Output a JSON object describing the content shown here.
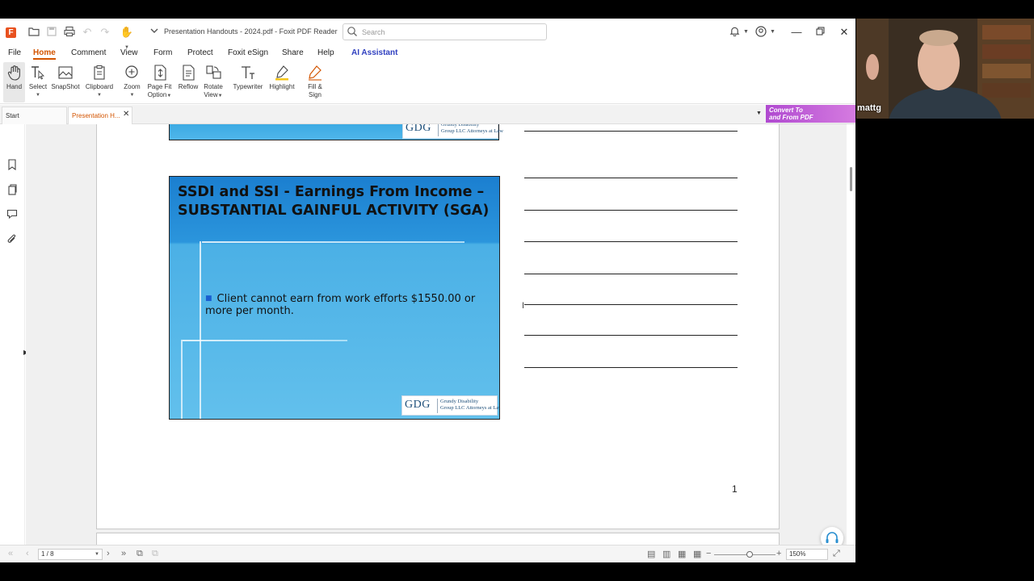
{
  "app": {
    "title": "Presentation Handouts - 2024.pdf - Foxit PDF Reader",
    "logo_icon": "foxit-logo-icon",
    "accent_color": "#d35400"
  },
  "search": {
    "placeholder": "Search"
  },
  "menu": [
    {
      "label": "File"
    },
    {
      "label": "Home"
    },
    {
      "label": "Comment"
    },
    {
      "label": "View"
    },
    {
      "label": "Form"
    },
    {
      "label": "Protect"
    },
    {
      "label": "Foxit eSign"
    },
    {
      "label": "Share"
    },
    {
      "label": "Help"
    },
    {
      "label": "AI Assistant"
    }
  ],
  "ribbon": {
    "hand": "Hand",
    "select": "Select",
    "snapshot": "SnapShot",
    "clipboard": "Clipboard",
    "zoom": "Zoom",
    "page_fit_1": "Page Fit",
    "page_fit_2": "Option",
    "reflow": "Reflow",
    "rotate_1": "Rotate",
    "rotate_2": "View",
    "typewriter": "Typewriter",
    "highlight": "Highlight",
    "fill_sign_1": "Fill &",
    "fill_sign_2": "Sign"
  },
  "tabs": {
    "start": "Start",
    "document": "Presentation H...",
    "convert_1": "Convert To",
    "convert_2": "and From PDF"
  },
  "slide": {
    "title": "SSDI and SSI - Earnings From Income – SUBSTANTIAL GAINFUL ACTIVITY (SGA)",
    "bullet": "Client cannot earn from work efforts $1550.00 or more per month.",
    "logo_abbr": "GDG",
    "logo_name_1": "Grundy Disability",
    "logo_name_2": "Group LLC Attorneys at Law"
  },
  "page": {
    "number": "1"
  },
  "status": {
    "page_indicator": "1 / 8",
    "zoom": "150%"
  },
  "webcam": {
    "name": "mattg"
  }
}
